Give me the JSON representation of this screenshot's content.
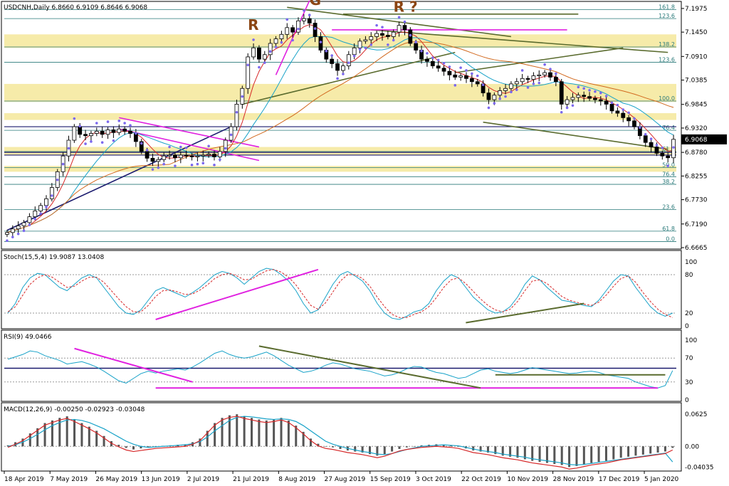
{
  "header": {
    "main": "USDCNH,Daily  6.8660 6.9109 6.8646 6.9068",
    "stoch": "Stoch(15,5,4) 19.9087 13.0408",
    "rsi": "RSI(9) 49.0466",
    "macd": "MACD(12,26,9) -0.00250 -0.02923 -0.03048"
  },
  "colors": {
    "up": "#000000",
    "down": "#000000",
    "fib_zone": "#f5e9a0",
    "fib_line": "#2a7a7a",
    "magenta": "#e020e0",
    "olive": "#5a6b2e",
    "navy": "#1a1a6e",
    "psar": "#7b68ee",
    "ma_fast": "#d62728",
    "ma_slow": "#17a2c8",
    "ma_long": "#d2691e"
  },
  "chart_data": [
    {
      "type": "candlestick",
      "title": "USDCNH,Daily",
      "ohlc_last": {
        "open": 6.866,
        "high": 6.9109,
        "low": 6.8646,
        "close": 6.9068
      },
      "current_price_label": "6.9068",
      "ylim": [
        6.6665,
        7.21
      ],
      "y_ticks": [
        "7.1975",
        "7.1450",
        "7.0910",
        "7.0385",
        "6.9845",
        "6.9320",
        "6.8780",
        "6.8255",
        "6.7730",
        "6.7190",
        "6.6665"
      ],
      "x_ticks": [
        "18 Apr 2019",
        "7 May 2019",
        "26 May 2019",
        "13 Jun 2019",
        "2 Jul 2019",
        "21 Jul 2019",
        "8 Aug 2019",
        "27 Aug 2019",
        "15 Sep 2019",
        "3 Oct 2019",
        "22 Oct 2019",
        "10 Nov 2019",
        "28 Nov 2019",
        "17 Dec 2019",
        "5 Jan 2020"
      ],
      "fib_labels": [
        {
          "text": "161.8",
          "price": 7.195
        },
        {
          "text": "123.6",
          "price": 7.175
        },
        {
          "text": "138.2",
          "price": 7.112
        },
        {
          "text": "123.6",
          "price": 7.078
        },
        {
          "text": "100.0",
          "price": 6.992
        },
        {
          "text": "76.4",
          "price": 6.927
        },
        {
          "text": "61.8",
          "price": 6.88
        },
        {
          "text": "50.0",
          "price": 6.844
        },
        {
          "text": "76.4",
          "price": 6.824
        },
        {
          "text": "38.2",
          "price": 6.807
        },
        {
          "text": "23.6",
          "price": 6.751
        },
        {
          "text": "61.8",
          "price": 6.703
        },
        {
          "text": "0.0",
          "price": 6.68
        }
      ],
      "pattern_labels": [
        "R",
        "G",
        "R ?"
      ],
      "close_path": [
        6.7,
        6.708,
        6.715,
        6.722,
        6.735,
        6.748,
        6.76,
        6.775,
        6.8,
        6.835,
        6.87,
        6.905,
        6.935,
        6.918,
        6.915,
        6.92,
        6.925,
        6.918,
        6.928,
        6.922,
        6.93,
        6.925,
        6.92,
        6.902,
        6.88,
        6.865,
        6.858,
        6.862,
        6.87,
        6.872,
        6.866,
        6.872,
        6.87,
        6.868,
        6.87,
        6.872,
        6.874,
        6.868,
        6.88,
        6.905,
        6.935,
        6.985,
        7.02,
        7.09,
        7.11,
        7.085,
        7.095,
        7.12,
        7.13,
        7.14,
        7.155,
        7.145,
        7.17,
        7.175,
        7.165,
        7.135,
        7.105,
        7.085,
        7.075,
        7.06,
        7.07,
        7.095,
        7.11,
        7.125,
        7.128,
        7.135,
        7.142,
        7.138,
        7.135,
        7.145,
        7.16,
        7.15,
        7.12,
        7.105,
        7.085,
        7.08,
        7.07,
        7.065,
        7.058,
        7.05,
        7.045,
        7.048,
        7.042,
        7.035,
        7.03,
        7.01,
        6.995,
        7.005,
        7.015,
        7.02,
        7.03,
        7.035,
        7.042,
        7.04,
        7.048,
        7.05,
        7.055,
        7.045,
        7.035,
        6.985,
        6.995,
        7.0,
        7.005,
        7.002,
        6.998,
        6.995,
        6.992,
        6.985,
        6.97,
        6.965,
        6.955,
        6.948,
        6.935,
        6.915,
        6.9,
        6.89,
        6.876,
        6.87,
        6.866,
        6.907
      ]
    },
    {
      "type": "line",
      "title": "Stoch(15,5,4)",
      "values_label": "19.9087 13.0408",
      "ylim": [
        0,
        100
      ],
      "y_ticks": [
        "100",
        "80",
        "20",
        "0"
      ],
      "series": [
        {
          "name": "Main",
          "values": [
            20,
            35,
            60,
            75,
            82,
            80,
            70,
            60,
            55,
            65,
            75,
            80,
            75,
            60,
            45,
            30,
            20,
            18,
            25,
            40,
            55,
            60,
            55,
            50,
            45,
            52,
            60,
            70,
            80,
            85,
            82,
            75,
            65,
            75,
            85,
            90,
            88,
            80,
            70,
            55,
            35,
            20,
            25,
            45,
            65,
            80,
            85,
            78,
            70,
            55,
            35,
            20,
            12,
            10,
            15,
            22,
            25,
            35,
            55,
            70,
            80,
            75,
            60,
            45,
            35,
            25,
            20,
            22,
            30,
            45,
            65,
            78,
            72,
            60,
            50,
            40,
            38,
            35,
            32,
            30,
            40,
            55,
            70,
            80,
            78,
            60,
            45,
            30,
            20,
            15,
            20
          ]
        },
        {
          "name": "Signal",
          "values": [
            22,
            30,
            48,
            65,
            75,
            80,
            76,
            68,
            60,
            62,
            70,
            76,
            76,
            68,
            55,
            42,
            30,
            22,
            22,
            32,
            46,
            55,
            56,
            53,
            49,
            50,
            56,
            64,
            74,
            80,
            82,
            78,
            72,
            73,
            80,
            86,
            88,
            84,
            76,
            64,
            48,
            32,
            26,
            36,
            53,
            70,
            80,
            80,
            74,
            62,
            45,
            30,
            18,
            13,
            13,
            18,
            22,
            30,
            44,
            60,
            72,
            75,
            66,
            54,
            42,
            32,
            25,
            22,
            26,
            38,
            55,
            70,
            72,
            66,
            56,
            46,
            40,
            37,
            34,
            32,
            37,
            48,
            62,
            74,
            78,
            68,
            52,
            38,
            26,
            18,
            13
          ]
        }
      ]
    },
    {
      "type": "line",
      "title": "RSI(9)",
      "values_label": "49.0466",
      "ylim": [
        0,
        100
      ],
      "y_ticks": [
        "100",
        "70",
        "30",
        "0"
      ],
      "series": [
        {
          "name": "RSI(9)",
          "values": [
            68,
            72,
            76,
            82,
            80,
            74,
            70,
            66,
            60,
            62,
            64,
            60,
            55,
            48,
            40,
            32,
            28,
            36,
            44,
            48,
            45,
            48,
            50,
            52,
            50,
            55,
            62,
            70,
            78,
            82,
            76,
            72,
            70,
            72,
            76,
            80,
            74,
            66,
            58,
            52,
            46,
            48,
            52,
            58,
            62,
            60,
            56,
            52,
            50,
            48,
            44,
            40,
            42,
            46,
            52,
            56,
            55,
            50,
            46,
            44,
            40,
            36,
            38,
            44,
            50,
            52,
            48,
            46,
            44,
            46,
            50,
            54,
            52,
            50,
            48,
            46,
            44,
            45,
            47,
            48,
            46,
            42,
            40,
            38,
            36,
            30,
            26,
            22,
            20,
            24,
            49
          ]
        }
      ]
    },
    {
      "type": "bar",
      "title": "MACD(12,26,9)",
      "values_label": "-0.00250 -0.02923 -0.03048",
      "ylim": [
        -0.045,
        0.065
      ],
      "y_ticks": [
        "0.0625",
        "0.00",
        "-0.04035"
      ],
      "series": [
        {
          "name": "MACD",
          "values": [
            0.002,
            0.008,
            0.015,
            0.025,
            0.035,
            0.045,
            0.05,
            0.055,
            0.058,
            0.052,
            0.045,
            0.038,
            0.03,
            0.02,
            0.01,
            0.003,
            -0.003,
            -0.006,
            -0.004,
            -0.002,
            0.0,
            0.001,
            0.002,
            0.003,
            0.004,
            0.008,
            0.015,
            0.03,
            0.045,
            0.055,
            0.06,
            0.062,
            0.058,
            0.055,
            0.052,
            0.05,
            0.052,
            0.055,
            0.05,
            0.04,
            0.028,
            0.015,
            0.005,
            0.0,
            -0.002,
            -0.005,
            -0.008,
            -0.01,
            -0.012,
            -0.015,
            -0.018,
            -0.015,
            -0.01,
            -0.005,
            -0.002,
            0.0,
            0.002,
            0.003,
            0.004,
            0.003,
            0.002,
            0.0,
            -0.004,
            -0.008,
            -0.01,
            -0.012,
            -0.015,
            -0.018,
            -0.02,
            -0.022,
            -0.025,
            -0.028,
            -0.03,
            -0.032,
            -0.034,
            -0.036,
            -0.04,
            -0.038,
            -0.035,
            -0.032,
            -0.03,
            -0.028,
            -0.025,
            -0.022,
            -0.02,
            -0.018,
            -0.016,
            -0.014,
            -0.012,
            -0.01,
            -0.003
          ]
        },
        {
          "name": "Signal",
          "values": [
            0.0,
            0.003,
            0.008,
            0.015,
            0.023,
            0.032,
            0.04,
            0.046,
            0.051,
            0.052,
            0.05,
            0.046,
            0.04,
            0.034,
            0.026,
            0.018,
            0.01,
            0.004,
            0.0,
            -0.002,
            -0.001,
            0.0,
            0.001,
            0.002,
            0.003,
            0.005,
            0.009,
            0.018,
            0.03,
            0.04,
            0.05,
            0.056,
            0.058,
            0.057,
            0.055,
            0.053,
            0.052,
            0.053,
            0.052,
            0.048,
            0.04,
            0.03,
            0.02,
            0.01,
            0.004,
            0.0,
            -0.004,
            -0.007,
            -0.01,
            -0.012,
            -0.015,
            -0.016,
            -0.014,
            -0.01,
            -0.006,
            -0.003,
            0.0,
            0.001,
            0.002,
            0.003,
            0.002,
            0.001,
            -0.002,
            -0.005,
            -0.008,
            -0.01,
            -0.012,
            -0.015,
            -0.017,
            -0.019,
            -0.021,
            -0.024,
            -0.026,
            -0.028,
            -0.03,
            -0.032,
            -0.035,
            -0.036,
            -0.035,
            -0.033,
            -0.031,
            -0.029,
            -0.027,
            -0.025,
            -0.023,
            -0.021,
            -0.019,
            -0.017,
            -0.015,
            -0.013,
            -0.03
          ]
        }
      ]
    }
  ]
}
